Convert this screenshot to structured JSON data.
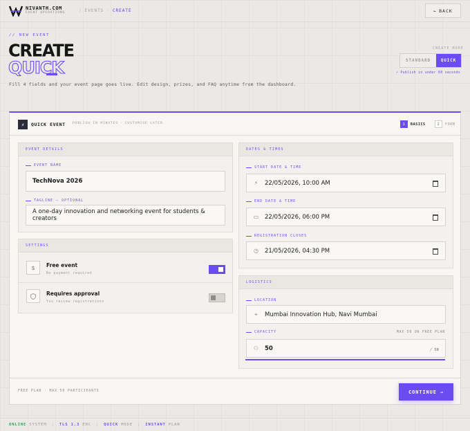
{
  "brand": {
    "name": "NIVANTH.COM",
    "subtitle": "EVENT OPERATIONS"
  },
  "breadcrumb": {
    "items": [
      "EVENTS",
      "CREATE"
    ]
  },
  "header": {
    "back_label": "BACK",
    "back_arrow": "←"
  },
  "hero": {
    "eyebrow": "// NEW EVENT",
    "title_line1": "CREATE",
    "title_line2": "QUICK",
    "description": "Fill 4 fields and your event page goes live. Edit design, prizes, and FAQ anytime from the dashboard."
  },
  "mode": {
    "label": "CREATE MODE",
    "options": [
      "STANDARD",
      "QUICK"
    ],
    "selected": "QUICK",
    "hint": "⚡ Publish in under 60 seconds"
  },
  "card": {
    "title": "QUICK EVENT",
    "subtitle_a": "PUBLISH IN MINUTES",
    "subtitle_b": "CUSTOMISE LATER",
    "steps": [
      {
        "num": "1",
        "label": "BASICS"
      },
      {
        "num": "2",
        "label": "FORM"
      }
    ]
  },
  "event_details": {
    "heading": "EVENT DETAILS",
    "name_label": "EVENT NAME",
    "name_value": "TechNova 2026",
    "tagline_label": "TAGLINE — OPTIONAL",
    "tagline_value": "A one-day innovation and networking event for students & creators"
  },
  "settings": {
    "heading": "SETTINGS",
    "free_event": {
      "title": "Free event",
      "subtitle": "No payment required",
      "enabled": true
    },
    "requires_approval": {
      "title": "Requires approval",
      "subtitle": "You review registrations",
      "enabled": false
    }
  },
  "dates": {
    "heading": "DATES & TIMES",
    "start_label": "START DATE & TIME",
    "start_value": "22/05/2026, 10:00 AM",
    "end_label": "END DATE & TIME",
    "end_value": "22/05/2026, 06:00 PM",
    "reg_label": "REGISTRATION CLOSES",
    "reg_value": "21/05/2026, 04:30 PM"
  },
  "logistics": {
    "heading": "LOGISTICS",
    "location_label": "LOCATION",
    "location_value": "Mumbai Innovation Hub, Navi Mumbai",
    "capacity_label": "CAPACITY",
    "capacity_max": "MAX 50 ON FREE PLAN",
    "capacity_value": "50",
    "capacity_limit": "/ 50",
    "capacity_fraction": 1.0
  },
  "footer": {
    "plan_text": "FREE PLAN · MAX 50 PARTICIPANTS",
    "continue_label": "CONTINUE",
    "continue_arrow": "→"
  },
  "statusbar": {
    "items": [
      {
        "key": "ONLINE",
        "value": "SYSTEM"
      },
      {
        "key": "TLS 1.3",
        "value": "ENC"
      },
      {
        "key": "QUICK",
        "value": "MODE"
      },
      {
        "key": "INSTANT",
        "value": "PLAN"
      }
    ]
  },
  "colors": {
    "accent": "#6b4cf0",
    "online": "#2aa45a",
    "background": "#ebe9e5"
  }
}
